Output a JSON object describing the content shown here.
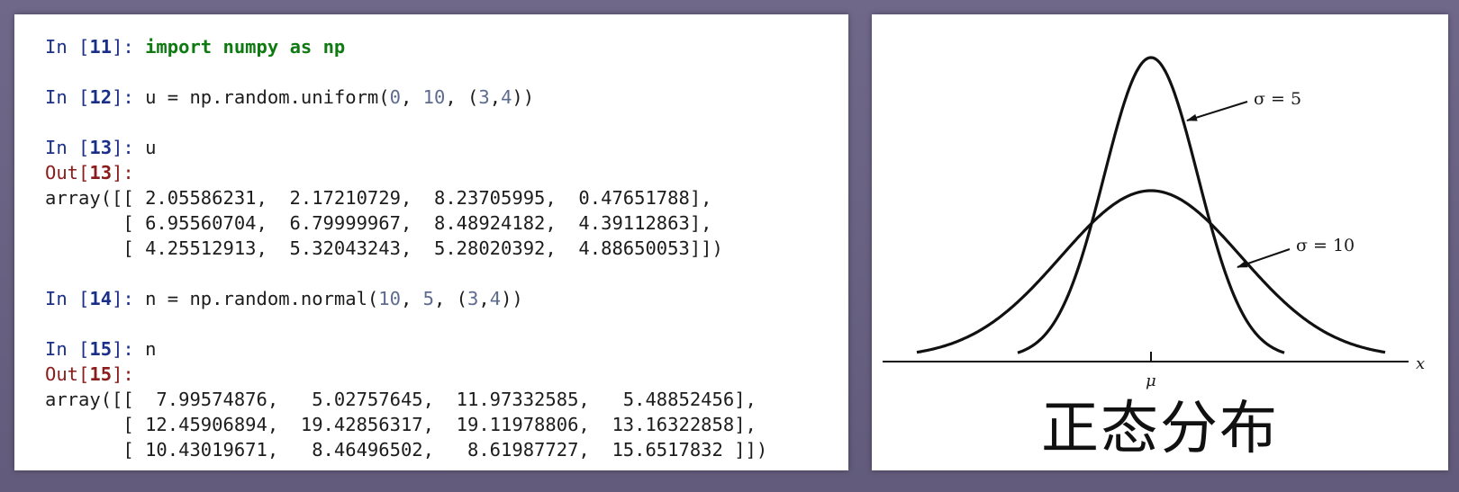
{
  "notebook": {
    "cells": [
      {
        "in_number": "11",
        "code": "import numpy as np"
      },
      {
        "in_number": "12",
        "code": "u = np.random.uniform(0, 10, (3,4))"
      },
      {
        "in_number": "13",
        "code": "u",
        "out_number": "13",
        "output": [
          "array([[ 2.05586231,  2.17210729,  8.23705995,  0.47651788],",
          "       [ 6.95560704,  6.79999967,  8.48924182,  4.39112863],",
          "       [ 4.25512913,  5.32043243,  5.28020392,  4.88650053]])"
        ]
      },
      {
        "in_number": "14",
        "code": "n = np.random.normal(10, 5, (3,4))"
      },
      {
        "in_number": "15",
        "code": "n",
        "out_number": "15",
        "output": [
          "array([[  7.99574876,   5.02757645,  11.97332585,   5.48852456],",
          "       [ 12.45906894,  19.42856317,  19.11978806,  13.16322858],",
          "       [ 10.43019671,   8.46496502,   8.61987727,  15.6517832 ]])"
        ]
      }
    ]
  },
  "figure": {
    "label_sigma5": "σ = 5",
    "label_sigma10": "σ = 10",
    "mu_label": "μ",
    "x_label": "x",
    "caption": "正态分布"
  }
}
